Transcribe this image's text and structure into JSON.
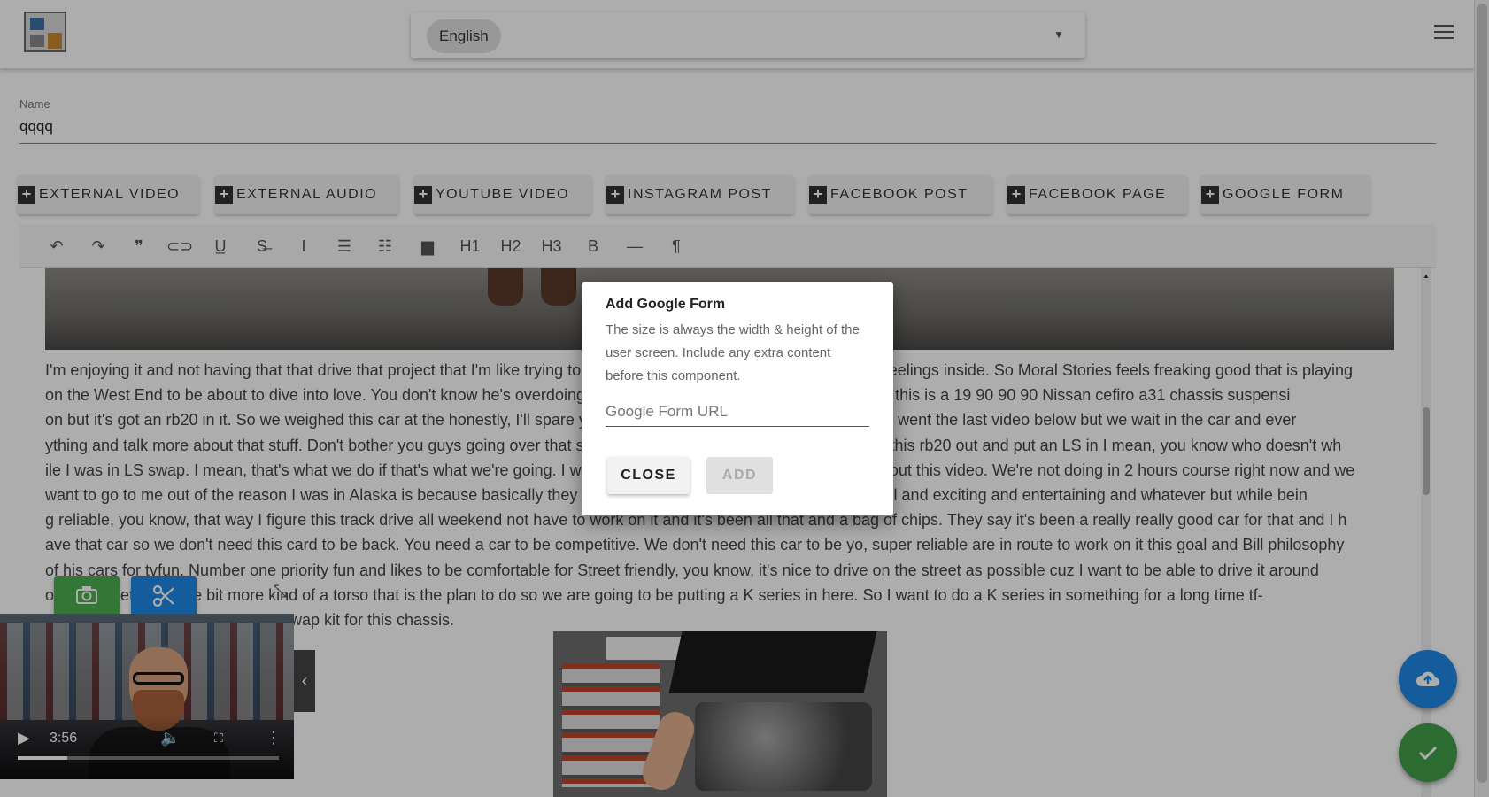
{
  "header": {
    "language": "English",
    "logo_icon": "app-logo-icon",
    "menu_icon": "hamburger-menu-icon"
  },
  "name_field": {
    "label": "Name",
    "value": "qqqq"
  },
  "embed_buttons": [
    {
      "label": "EXTERNAL VIDEO"
    },
    {
      "label": "EXTERNAL AUDIO"
    },
    {
      "label": "YOUTUBE VIDEO"
    },
    {
      "label": "INSTAGRAM POST"
    },
    {
      "label": "FACEBOOK POST"
    },
    {
      "label": "FACEBOOK PAGE"
    },
    {
      "label": "GOOGLE FORM"
    }
  ],
  "toolbar": {
    "items": [
      {
        "name": "undo-icon",
        "glyph": "↶"
      },
      {
        "name": "redo-icon",
        "glyph": "↷"
      },
      {
        "name": "quote-icon",
        "glyph": "❞"
      },
      {
        "name": "link-icon",
        "glyph": "⊂⊃"
      },
      {
        "name": "underline-icon",
        "glyph": "U̲"
      },
      {
        "name": "strikethrough-icon",
        "glyph": "S̶"
      },
      {
        "name": "italic-icon",
        "glyph": "I"
      },
      {
        "name": "bullet-list-icon",
        "glyph": "☰"
      },
      {
        "name": "numbered-list-icon",
        "glyph": "☷"
      },
      {
        "name": "image-icon",
        "glyph": "▆"
      },
      {
        "name": "h1-icon",
        "glyph": "H1"
      },
      {
        "name": "h2-icon",
        "glyph": "H2"
      },
      {
        "name": "h3-icon",
        "glyph": "H3"
      },
      {
        "name": "bold-icon",
        "glyph": "B"
      },
      {
        "name": "horizontal-rule-icon",
        "glyph": "—"
      },
      {
        "name": "paragraph-icon",
        "glyph": "¶"
      }
    ]
  },
  "content": {
    "paragraph_lines": [
      "I'm enjoying it and not having that that drive that project that I'm like trying to build this so I'm not trying to make it like a feelings inside. So Moral Stories feels freaking good that is playing",
      "on the West End to be about to dive into love. You don't know he's overdoing something Monday is a good like they took this is a 19 90 90 90 Nissan cefiro a31 chassis suspensi",
      "on but it's got an rb20 in it. So we weighed this car at the honestly, I'll spare you the details but check out our last video. I went the last video below but we wait in the car and ever",
      "ything and talk more about that stuff. Don't bother you guys going over that stuff again. We're probably gonna be pulling this rb20 out and put an LS in I mean, you know who doesn't wh",
      "ile I was in LS swap. I mean, that's what we do if that's what we're going. I went and picked that car up so go and check out this video. We're not doing in 2 hours course right now and we",
      " want to go to me out of the reason I was in Alaska is because basically they wanted this car to be as fast and as powerful and exciting and entertaining and whatever but while bein",
      "g reliable, you know, that way I figure this track drive all weekend not have to work on it and it's been all that and a bag of chips. They say it's been a really really good car for that and I h",
      "ave that car so we don't need this card to be back. You need a car to be competitive. We don't need this car to be yo, super reliable are in route to work on it this goal and Bill philosophy",
      " of his cars for tvfun. Number one priority fun and likes to be comfortable for Street friendly, you know, it's nice to drive on the street as possible cuz I want to be able to drive it around",
      "on the street be a little bit more kind of a torso that is the plan to do so we are going to be putting a K series in here. So I want to do a K series in something for a long time tf-",
      "swap kit for this chassis."
    ]
  },
  "video_player": {
    "time": "3:56",
    "progress": 0.19,
    "play_icon": "play-icon",
    "volume_icon": "volume-icon",
    "fullscreen_icon": "fullscreen-icon",
    "more_icon": "more-vertical-icon",
    "collapse_glyph": "‹",
    "camera_icon": "camera-icon",
    "scissors_icon": "scissors-icon"
  },
  "fabs": {
    "upload_icon": "cloud-upload-icon",
    "done_icon": "check-icon"
  },
  "modal": {
    "title": "Add Google Form",
    "description": "The size is always the width & height of the user screen. Include any extra content before this component.",
    "input_placeholder": "Google Form URL",
    "close_label": "CLOSE",
    "add_label": "ADD"
  },
  "colors": {
    "overlay": "rgba(0,0,0,0.32)",
    "camera_button": "#4caf50",
    "cut_button": "#1e88e5",
    "upload_fab": "#1e88e5",
    "done_fab": "#43a047"
  }
}
